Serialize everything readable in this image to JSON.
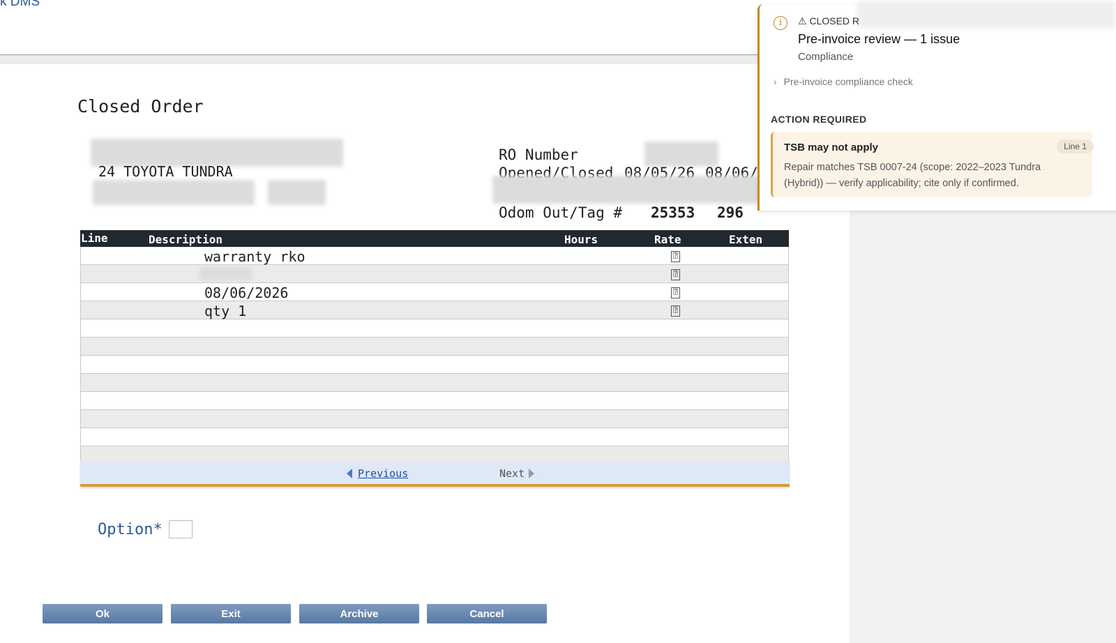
{
  "app": {
    "title": "k DMS"
  },
  "page": {
    "title": "Closed Order"
  },
  "vehicle": {
    "description": "24 TOYOTA TUNDRA"
  },
  "header_fields": {
    "ro_number_label": "RO Number",
    "opened_closed_label": "Opened/Closed",
    "opened_value": "08/05/26",
    "closed_value": "08/06/",
    "odom_label": "Odom Out/Tag #",
    "odom_value": "25353",
    "tag_value": "296"
  },
  "grid": {
    "columns": [
      "Line",
      "Description",
      "Hours",
      "Rate",
      "Exten"
    ],
    "rows": [
      {
        "description": "warranty rko",
        "rate_icon": "missing-glyph"
      },
      {
        "description": "",
        "rate_icon": "missing-glyph"
      },
      {
        "description": "08/06/2026",
        "rate_icon": "missing-glyph"
      },
      {
        "description": "qty 1",
        "rate_icon": "missing-glyph"
      }
    ],
    "rate_glyph": "⍰",
    "empty_rows": 8
  },
  "pager": {
    "previous": "Previous",
    "next": "Next"
  },
  "option": {
    "label": "Option*",
    "value": ""
  },
  "buttons": {
    "ok": "Ok",
    "exit": "Exit",
    "archive": "Archive",
    "cancel": "Cancel"
  },
  "review_panel": {
    "status": "⚠ CLOSED R",
    "title": "Pre-invoice review — 1 issue",
    "subtitle": "Compliance",
    "check_label": "Pre-invoice compliance check",
    "action_heading": "ACTION REQUIRED",
    "issue": {
      "title": "TSB may not apply",
      "badge": "Line 1",
      "body": "Repair matches TSB 0007-24 (scope: 2022–2023 Tundra (Hybrid)) — verify applicability; cite only if confirmed."
    }
  },
  "colors": {
    "accent": "#c48a28",
    "grid_header": "#22282e",
    "button": "#6886b0",
    "link": "#1f4fa3"
  }
}
